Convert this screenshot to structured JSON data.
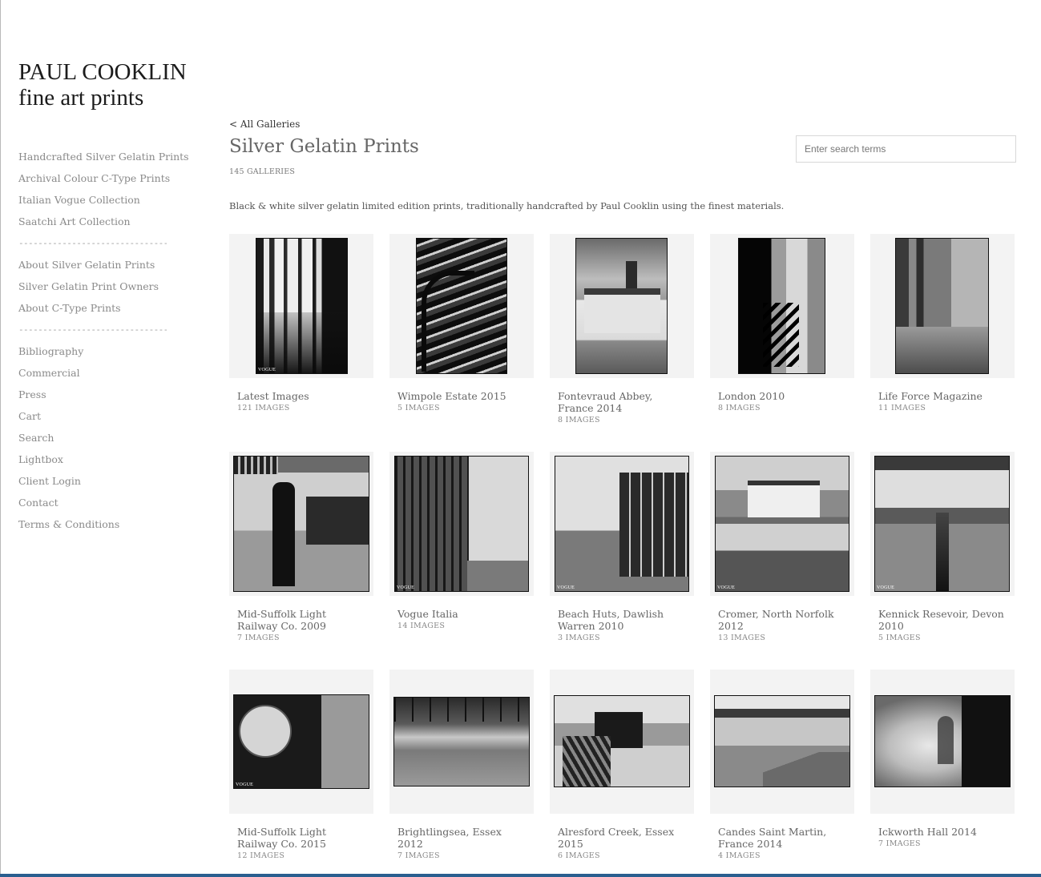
{
  "site": {
    "title_line1": "PAUL COOKLIN",
    "title_line2": "fine art prints"
  },
  "nav": {
    "group1": [
      "Handcrafted Silver Gelatin Prints",
      "Archival Colour C-Type Prints",
      "Italian Vogue Collection",
      "Saatchi Art Collection"
    ],
    "separator": "-------------------------------------",
    "group2": [
      "About Silver Gelatin Prints",
      "Silver Gelatin Print Owners",
      "About C-Type Prints"
    ],
    "group3": [
      "Bibliography",
      "Commercial",
      "Press",
      "Cart",
      "Search",
      "Lightbox",
      "Client Login",
      "Contact",
      "Terms & Conditions"
    ]
  },
  "header": {
    "back_link": "< All Galleries",
    "title": "Silver Gelatin Prints",
    "count": "145 GALLERIES",
    "search_placeholder": "Enter search terms",
    "description": "Black & white silver gelatin limited edition prints, traditionally handcrafted by Paul Cooklin using the finest materials."
  },
  "galleries": [
    {
      "title": "Latest Images",
      "count": "121 IMAGES",
      "watermark": "VOGUE"
    },
    {
      "title": "Wimpole Estate 2015",
      "count": "5 IMAGES",
      "watermark": ""
    },
    {
      "title": "Fontevraud Abbey, France 2014",
      "count": "8 IMAGES",
      "watermark": ""
    },
    {
      "title": "London 2010",
      "count": "8 IMAGES",
      "watermark": ""
    },
    {
      "title": "Life Force Magazine",
      "count": "11 IMAGES",
      "watermark": ""
    },
    {
      "title": "Mid-Suffolk Light Railway Co. 2009",
      "count": "7 IMAGES",
      "watermark": ""
    },
    {
      "title": "Vogue Italia",
      "count": "14 IMAGES",
      "watermark": "VOGUE"
    },
    {
      "title": "Beach Huts, Dawlish Warren 2010",
      "count": "3 IMAGES",
      "watermark": "VOGUE"
    },
    {
      "title": "Cromer, North Norfolk 2012",
      "count": "13 IMAGES",
      "watermark": "VOGUE"
    },
    {
      "title": "Kennick Resevoir, Devon 2010",
      "count": "5 IMAGES",
      "watermark": "VOGUE"
    },
    {
      "title": "Mid-Suffolk Light Railway Co. 2015",
      "count": "12 IMAGES",
      "watermark": "VOGUE"
    },
    {
      "title": "Brightlingsea, Essex 2012",
      "count": "7 IMAGES",
      "watermark": ""
    },
    {
      "title": "Alresford Creek, Essex 2015",
      "count": "6 IMAGES",
      "watermark": ""
    },
    {
      "title": "Candes Saint Martin, France 2014",
      "count": "4 IMAGES",
      "watermark": ""
    },
    {
      "title": "Ickworth Hall 2014",
      "count": "7 IMAGES",
      "watermark": ""
    }
  ]
}
